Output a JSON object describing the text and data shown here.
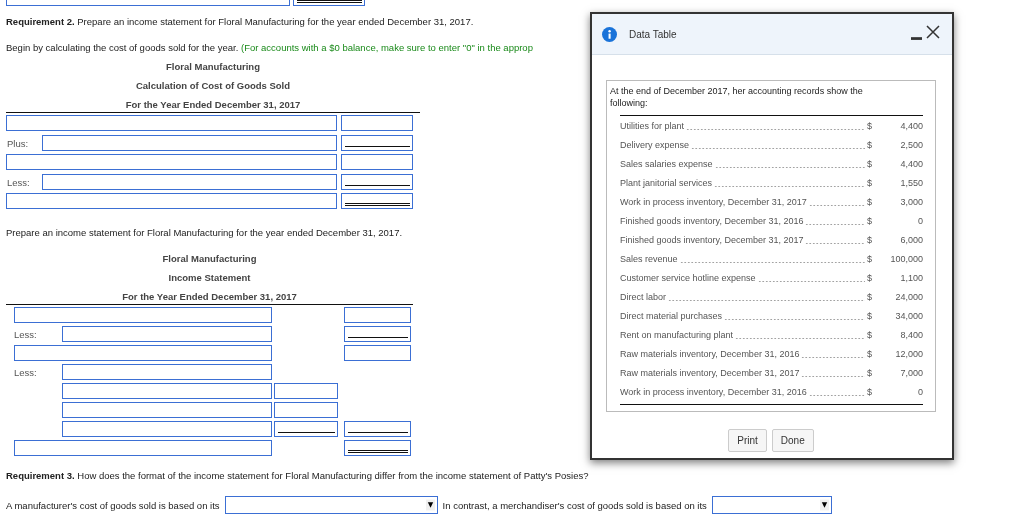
{
  "top_partial_row": {
    "amount": {
      "kind": "double"
    }
  },
  "requirement2": {
    "heading": "Requirement 2.",
    "text": "Prepare an income statement for Floral Manufacturing for the year ended December 31, 2017.",
    "instruction": "Begin by calculating the cost of goods sold for the year.",
    "hint": "(For accounts with a $0 balance, make sure to enter \"0\" in the approp"
  },
  "cogs_schedule": {
    "titles": [
      "Floral Manufacturing",
      "Calculation of Cost of Goods Sold",
      "For the Year Ended December 31, 2017"
    ],
    "rows": [
      {
        "indented": false,
        "amount": {
          "kind": "plain"
        }
      },
      {
        "label": "Plus:",
        "indented": true,
        "amount": {
          "kind": "single"
        }
      },
      {
        "indented": false,
        "amount": {
          "kind": "plain"
        }
      },
      {
        "label": "Less:",
        "indented": true,
        "amount": {
          "kind": "single"
        }
      },
      {
        "indented": false,
        "amount": {
          "kind": "double"
        }
      }
    ]
  },
  "income_prompt": "Prepare an income statement for Floral Manufacturing for the year ended December 31, 2017.",
  "income_statement": {
    "titles": [
      "Floral Manufacturing",
      "Income Statement",
      "For the Year Ended December 31, 2017"
    ],
    "rows": [
      {
        "indented": false,
        "right": {
          "kind": "plain"
        }
      },
      {
        "label": "Less:",
        "indented": true,
        "right": {
          "kind": "single"
        }
      },
      {
        "indented": false,
        "right": {
          "kind": "plain"
        }
      },
      {
        "label": "Less:",
        "indented": true
      },
      {
        "indented": true,
        "middle": {
          "kind": "plain"
        }
      },
      {
        "indented": true,
        "middle": {
          "kind": "plain"
        }
      },
      {
        "indented": true,
        "middle": {
          "kind": "single"
        },
        "right": {
          "kind": "single"
        }
      },
      {
        "indented": false,
        "right": {
          "kind": "double"
        }
      }
    ]
  },
  "requirement3": {
    "heading": "Requirement 3.",
    "text": "How does the format of the income statement for Floral Manufacturing differ from the income statement of Patty's Posies?",
    "sentence_1": "A manufacturer's cost of goods sold is based on its",
    "sentence_2": "In contrast, a merchandiser's cost of goods sold is based on its"
  },
  "dialog": {
    "title": "Data Table",
    "intro": "At the end of December 2017, her accounting records show the following:",
    "items": [
      {
        "label": "Utilities for plant",
        "currency": "$",
        "value": "4,400"
      },
      {
        "label": "Delivery expense",
        "currency": "$",
        "value": "2,500"
      },
      {
        "label": "Sales salaries expense",
        "currency": "$",
        "value": "4,400"
      },
      {
        "label": "Plant janitorial services",
        "currency": "$",
        "value": "1,550"
      },
      {
        "label": "Work in process inventory, December 31, 2017",
        "currency": "$",
        "value": "3,000"
      },
      {
        "label": "Finished goods inventory, December 31, 2016",
        "currency": "$",
        "value": "0"
      },
      {
        "label": "Finished goods inventory, December 31, 2017",
        "currency": "$",
        "value": "6,000"
      },
      {
        "label": "Sales revenue",
        "currency": "$",
        "value": "100,000"
      },
      {
        "label": "Customer service hotline expense",
        "currency": "$",
        "value": "1,100"
      },
      {
        "label": "Direct labor",
        "currency": "$",
        "value": "24,000"
      },
      {
        "label": "Direct material purchases",
        "currency": "$",
        "value": "34,000"
      },
      {
        "label": "Rent on manufacturing plant",
        "currency": "$",
        "value": "8,400"
      },
      {
        "label": "Raw materials inventory, December 31, 2016",
        "currency": "$",
        "value": "12,000"
      },
      {
        "label": "Raw materials inventory, December 31, 2017",
        "currency": "$",
        "value": "7,000"
      },
      {
        "label": "Work in process inventory, December 31, 2016",
        "currency": "$",
        "value": "0"
      }
    ],
    "buttons": [
      "Print",
      "Done"
    ]
  }
}
